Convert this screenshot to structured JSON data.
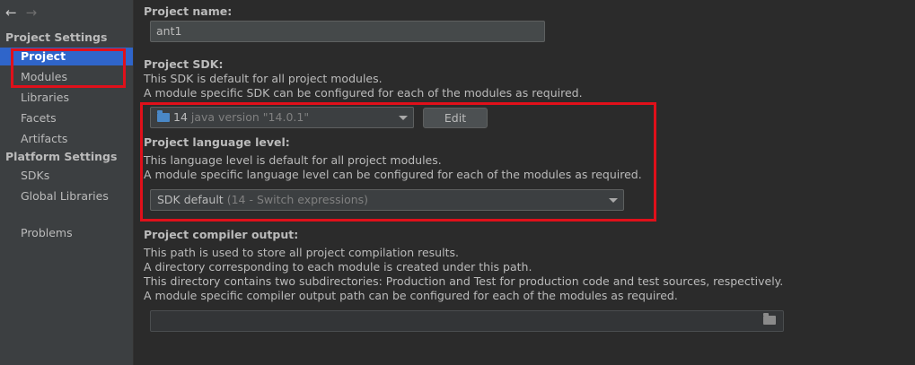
{
  "nav": {
    "back": "←",
    "forward": "→"
  },
  "sidebar": {
    "project_settings_header": "Project Settings",
    "project_items": [
      "Project",
      "Modules",
      "Libraries",
      "Facets",
      "Artifacts"
    ],
    "platform_settings_header": "Platform Settings",
    "platform_items": [
      "SDKs",
      "Global Libraries"
    ],
    "problems": "Problems",
    "selected": "Project"
  },
  "main": {
    "project_name": {
      "label": "Project name:",
      "value": "ant1"
    },
    "project_sdk": {
      "label": "Project SDK:",
      "desc1": "This SDK is default for all project modules.",
      "desc2": "A module specific SDK can be configured for each of the modules as required.",
      "selected_version": "14",
      "selected_detail": "java version \"14.0.1\"",
      "edit_label": "Edit"
    },
    "language_level": {
      "label": "Project language level:",
      "desc1": "This language level is default for all project modules.",
      "desc2": "A module specific language level can be configured for each of the modules as required.",
      "selected": "SDK default",
      "selected_detail": "(14 - Switch expressions)"
    },
    "compiler_output": {
      "label": "Project compiler output:",
      "desc1": "This path is used to store all project compilation results.",
      "desc2": "A directory corresponding to each module is created under this path.",
      "desc3": "This directory contains two subdirectories: Production and Test for production code and test sources, respectively.",
      "desc4": "A module specific compiler output path can be configured for each of the modules as required.",
      "value": ""
    }
  },
  "colors": {
    "background": "#2b2b2b",
    "sidebar": "#3c3f41",
    "selection": "#2f65ca",
    "highlight": "#e0101a"
  }
}
